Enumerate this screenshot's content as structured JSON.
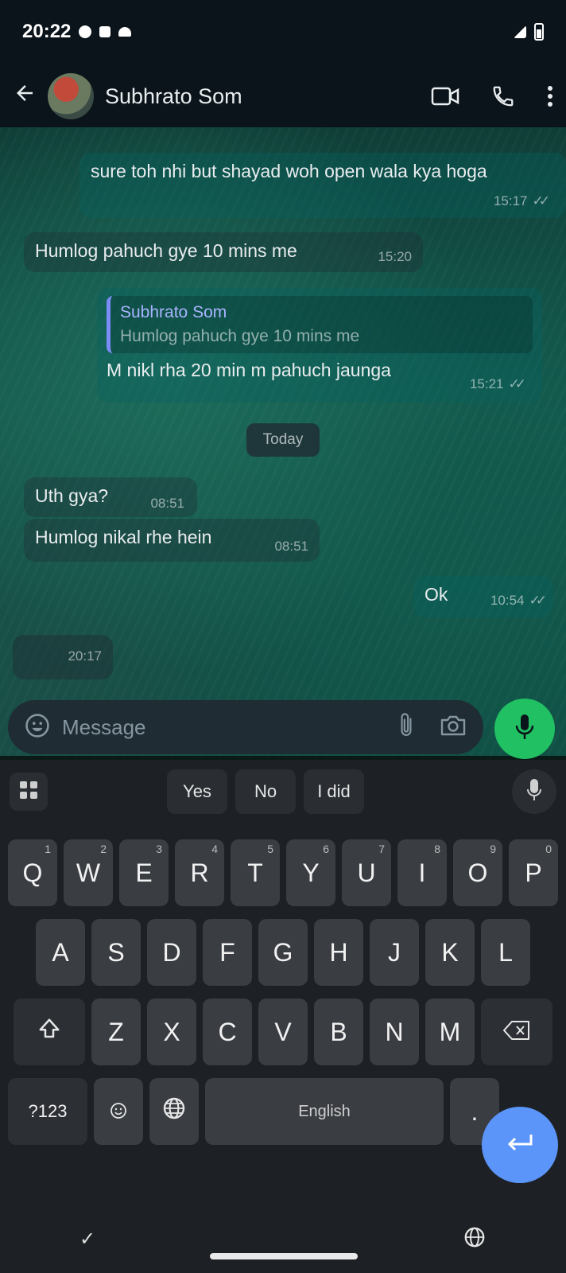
{
  "status_bar": {
    "time": "20:22",
    "battery_text": ""
  },
  "header": {
    "contact_name": "Subhrato Som"
  },
  "messages": [
    {
      "id": "m1",
      "dir": "out",
      "text": "sure toh nhi but shayad woh open wala kya hoga",
      "time": "15:17",
      "ticks": "✓✓"
    },
    {
      "id": "m2",
      "dir": "in",
      "text": "Humlog pahuch gye 10 mins me",
      "time": "15:20"
    },
    {
      "id": "m3",
      "dir": "out",
      "reply_name": "Subhrato Som",
      "reply_text": "Humlog pahuch gye 10 mins me",
      "text": "M nikl rha 20 min m pahuch jaunga",
      "time": "15:21",
      "ticks": "✓✓"
    },
    {
      "id": "m4",
      "dir": "in",
      "text": "Uth gya?",
      "time": "08:51"
    },
    {
      "id": "m5",
      "dir": "in",
      "text": "Humlog nikal rhe hein",
      "time": "08:51"
    },
    {
      "id": "m6",
      "dir": "out",
      "text": "Ok",
      "time": "10:54",
      "ticks": "✓✓"
    },
    {
      "id": "m7",
      "dir": "in",
      "text": "",
      "time": "20:17"
    }
  ],
  "date_divider": "Today",
  "composer": {
    "placeholder": "Message"
  },
  "keyboard": {
    "suggestions": [
      "Yes",
      "No",
      "I did"
    ],
    "row1": [
      "Q",
      "W",
      "E",
      "R",
      "T",
      "Y",
      "U",
      "I",
      "O",
      "P"
    ],
    "row1_nums": [
      "1",
      "2",
      "3",
      "4",
      "5",
      "6",
      "7",
      "8",
      "9",
      "0"
    ],
    "row2": [
      "A",
      "S",
      "D",
      "F",
      "G",
      "H",
      "J",
      "K",
      "L"
    ],
    "row3": [
      "Z",
      "X",
      "C",
      "V",
      "B",
      "N",
      "M"
    ],
    "sym_label": "?123",
    "comma_label": ",",
    "space_label": "English",
    "period_label": "."
  },
  "colors": {
    "accent_green": "#21c063",
    "enter_blue": "#5b95f9",
    "outgoing": "#056162"
  }
}
